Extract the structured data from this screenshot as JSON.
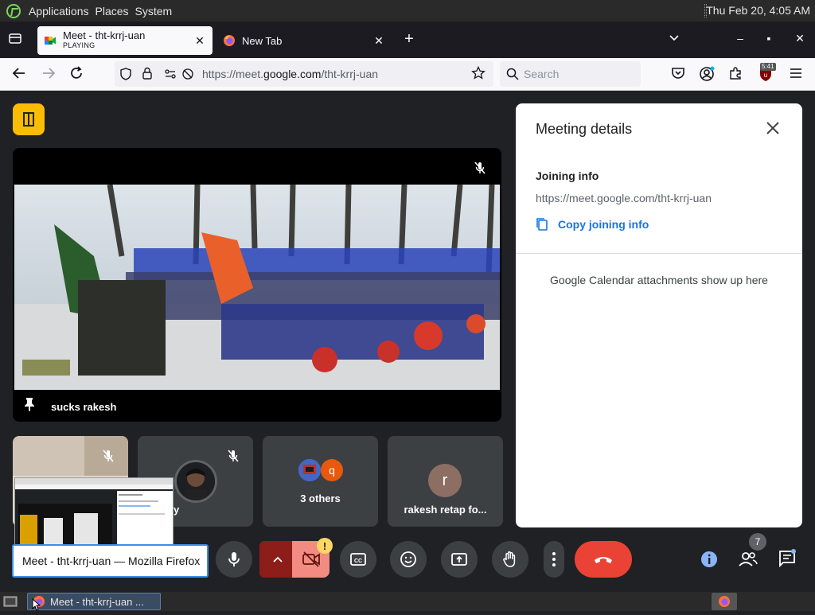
{
  "panel": {
    "menus": [
      "Applications",
      "Places",
      "System"
    ],
    "clock": "Thu Feb 20,  4:05 AM"
  },
  "tabs": [
    {
      "title": "Meet - tht-krrj-uan",
      "subtitle": "PLAYING"
    },
    {
      "title": "New Tab",
      "subtitle": ""
    }
  ],
  "nav": {
    "url_prefix": "https://meet.",
    "url_domain": "google.com",
    "url_path": "/tht-krrj-uan",
    "search_placeholder": "Search",
    "ext_badge": "5:41"
  },
  "main_tile": {
    "name": "sucks rakesh"
  },
  "tiles": [
    {
      "label": ""
    },
    {
      "label": "y"
    },
    {
      "avatars": [
        "q"
      ],
      "label": "3 others"
    },
    {
      "avatar": "r",
      "label": "rakesh retap fo..."
    }
  ],
  "details": {
    "title": "Meeting details",
    "joining_heading": "Joining info",
    "joining_url": "https://meet.google.com/tht-krrj-uan",
    "copy_label": "Copy joining info",
    "calendar_note": "Google Calendar attachments show up here"
  },
  "controls": {
    "participants_count": "7",
    "camera_warning": "!"
  },
  "tooltip": "Meet - tht-krrj-uan — Mozilla Firefox",
  "taskbar": {
    "window_label": "Meet - tht-krrj-uan ..."
  },
  "colors": {
    "meet_bg": "#202124",
    "tile_bg": "#3c4043",
    "end_call_red": "#ea4335",
    "accent_blue": "#1a73e8",
    "room_badge_yellow": "#fbbc04",
    "info_blue": "#8ab4f8"
  }
}
